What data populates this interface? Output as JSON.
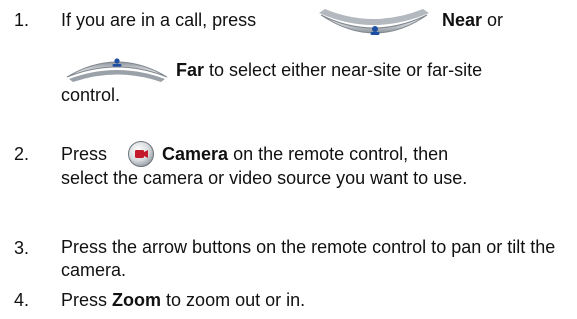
{
  "steps": [
    {
      "number": "1.",
      "line1_prefix": "If you are in a call, press",
      "near_label": "Near",
      "line1_suffix": "or",
      "far_label": "Far",
      "line2_suffix": "to select either near-site or far-site",
      "line3": "control.",
      "icons": [
        "near-button-icon",
        "far-button-icon"
      ]
    },
    {
      "number": "2.",
      "prefix": "Press",
      "camera_label": "Camera",
      "line1_suffix": "on the remote control, then",
      "rest": "select the camera or video source you want to use.",
      "icons": [
        "camera-button-icon"
      ]
    },
    {
      "number": "3.",
      "text": "Press the arrow buttons on the remote control to pan or tilt the camera."
    },
    {
      "number": "4.",
      "prefix": "Press",
      "zoom_label": "Zoom",
      "suffix": "to zoom out or in."
    }
  ],
  "colors": {
    "text": "#111111",
    "button_light": "#e8eaec",
    "button_mid": "#b7bcc2",
    "button_dark": "#7f868d",
    "accent_blue": "#1f4fa3",
    "camera_red": "#c4182b"
  }
}
